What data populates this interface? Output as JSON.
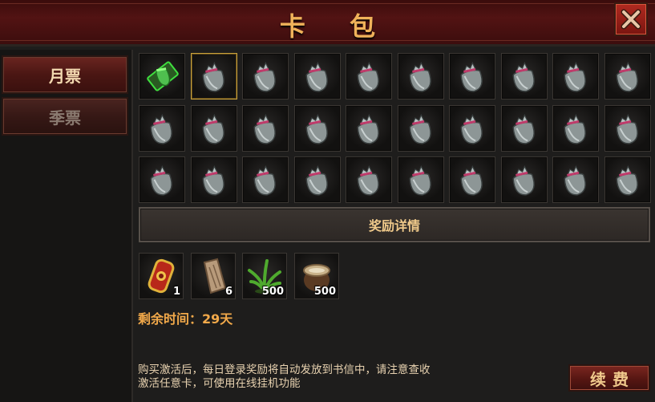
{
  "window": {
    "title": "卡 包"
  },
  "tabs": [
    {
      "label": "月票",
      "active": true
    },
    {
      "label": "季票",
      "active": false
    }
  ],
  "grid": {
    "rows": 3,
    "cols": 10,
    "first_cell_icon": "green-ticket-icon",
    "cell_icon": "treasure-bag-icon",
    "selected_index": 1
  },
  "rewards": {
    "header": "奖励详情",
    "items": [
      {
        "icon": "red-token-icon",
        "count": "1"
      },
      {
        "icon": "wooden-plank-icon",
        "count": "6"
      },
      {
        "icon": "green-herb-icon",
        "count": "500"
      },
      {
        "icon": "cloth-sack-icon",
        "count": "500"
      }
    ]
  },
  "remaining": "剩余时间：29天",
  "description": {
    "line1": "购买激活后，每日登录奖励将自动发放到书信中，请注意查收",
    "line2": "激活任意卡，可使用在线挂机功能"
  },
  "renew_label": "续费",
  "colors": {
    "accent": "#f0b25a",
    "selection": "#c9a23c",
    "panel": "#1e1d1c"
  }
}
